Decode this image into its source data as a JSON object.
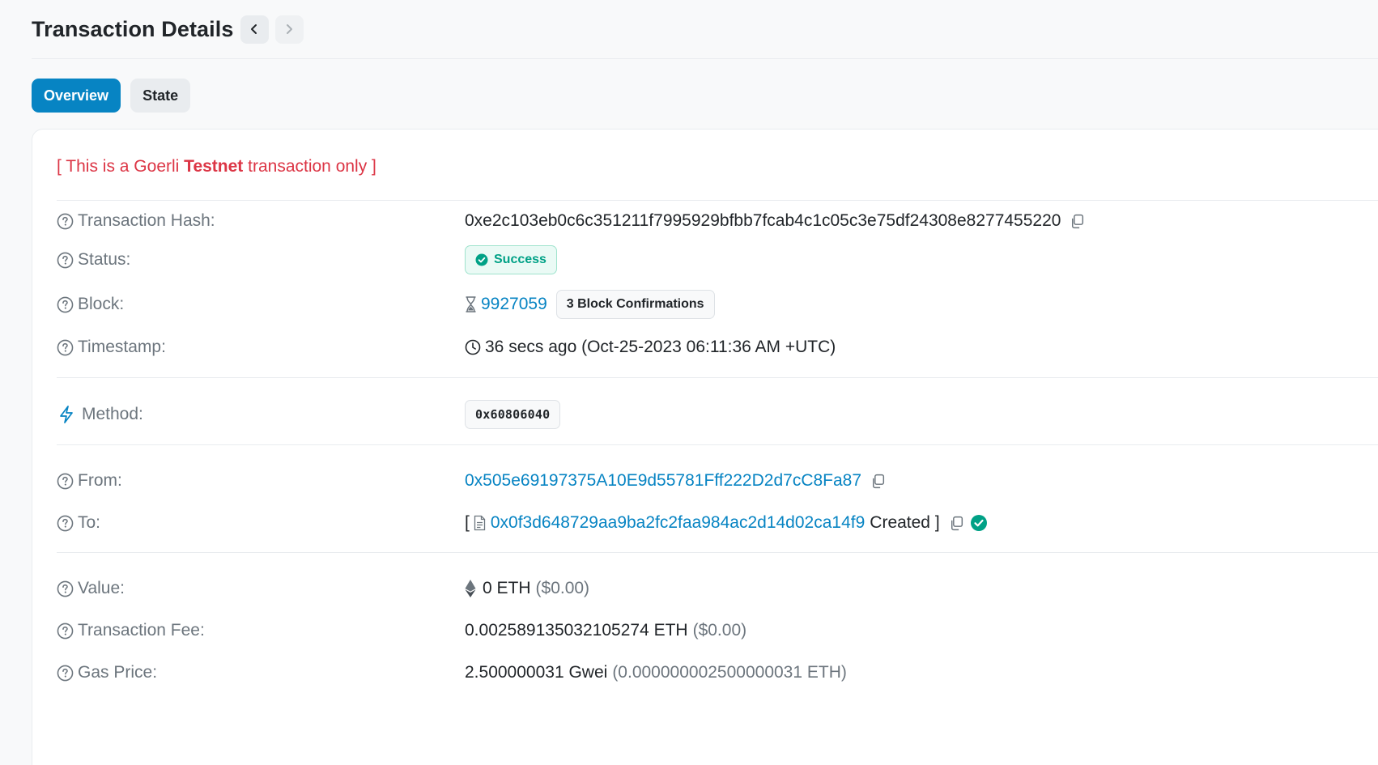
{
  "header": {
    "title": "Transaction Details"
  },
  "tabs": [
    {
      "label": "Overview",
      "active": true
    },
    {
      "label": "State",
      "active": false
    }
  ],
  "notice": {
    "prefix": "[ This is a Goerli ",
    "bold": "Testnet",
    "suffix": " transaction only ]"
  },
  "fields": {
    "hash": {
      "label": "Transaction Hash:",
      "value": "0xe2c103eb0c6c351211f7995929bfbb7fcab4c1c05c3e75df24308e8277455220"
    },
    "status": {
      "label": "Status:",
      "value": "Success"
    },
    "block": {
      "label": "Block:",
      "value": "9927059",
      "confirmations": "3 Block Confirmations"
    },
    "timestamp": {
      "label": "Timestamp:",
      "value": "36 secs ago (Oct-25-2023 06:11:36 AM +UTC)"
    },
    "method": {
      "label": "Method:",
      "value": "0x60806040"
    },
    "from": {
      "label": "From:",
      "value": "0x505e69197375A10E9d55781Fff222D2d7cC8Fa87"
    },
    "to": {
      "label": "To:",
      "open": "[",
      "value": "0x0f3d648729aa9ba2fc2faa984ac2d14d02ca14f9",
      "suffix": "Created ]"
    },
    "value": {
      "label": "Value:",
      "amount": "0 ETH",
      "usd": "($0.00)"
    },
    "fee": {
      "label": "Transaction Fee:",
      "amount": "0.002589135032105274 ETH",
      "usd": "($0.00)"
    },
    "gas": {
      "label": "Gas Price:",
      "amount": "2.500000031 Gwei",
      "eth": "(0.000000002500000031 ETH)"
    }
  },
  "colors": {
    "link": "#0784c3",
    "success": "#00a186",
    "danger": "#dc3545",
    "muted": "#6c757d"
  },
  "icons": {
    "help": "question-circle-icon",
    "copy": "copy-icon",
    "block": "hourglass-icon",
    "clock": "clock-icon",
    "method": "lightning-icon",
    "contract": "file-icon",
    "verified": "check-circle-icon",
    "eth": "ethereum-icon"
  }
}
